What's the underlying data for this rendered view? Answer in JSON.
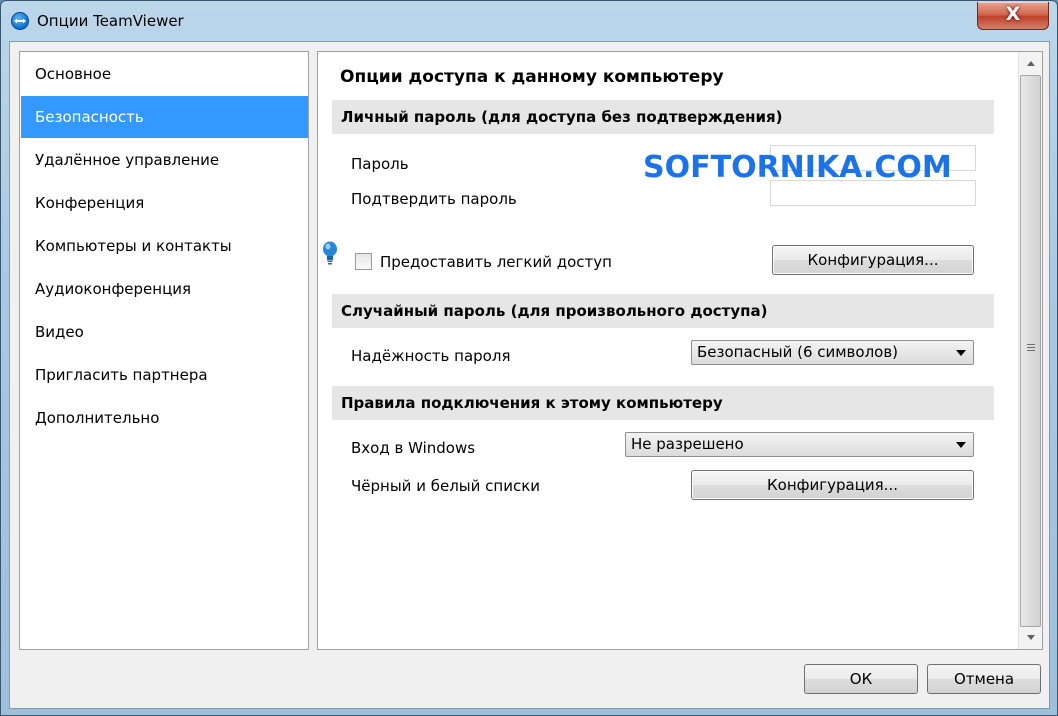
{
  "window": {
    "title": "Опции TeamViewer",
    "close_label": "X"
  },
  "sidebar": {
    "items": [
      {
        "label": "Основное",
        "active": false
      },
      {
        "label": "Безопасность",
        "active": true
      },
      {
        "label": "Удалённое управление",
        "active": false
      },
      {
        "label": "Конференция",
        "active": false
      },
      {
        "label": "Компьютеры и контакты",
        "active": false
      },
      {
        "label": "Аудиоконференция",
        "active": false
      },
      {
        "label": "Видео",
        "active": false
      },
      {
        "label": "Пригласить партнера",
        "active": false
      },
      {
        "label": "Дополнительно",
        "active": false
      }
    ]
  },
  "main": {
    "title": "Опции доступа к данному компьютеру",
    "watermark": "SOFTORNIKA.COM",
    "personal": {
      "header": "Личный пароль (для доступа без подтверждения)",
      "password_label": "Пароль",
      "password_value": "",
      "confirm_label": "Подтвердить пароль",
      "confirm_value": "",
      "easy_access_label": "Предоставить легкий доступ",
      "easy_access_checked": false,
      "config_button": "Конфигурация..."
    },
    "random": {
      "header": "Случайный пароль (для произвольного доступа)",
      "strength_label": "Надёжность пароля",
      "strength_value": "Безопасный (6 символов)"
    },
    "rules": {
      "header": "Правила подключения к этому компьютеру",
      "windows_login_label": "Вход в Windows",
      "windows_login_value": "Не разрешено",
      "lists_label": "Чёрный и белый списки",
      "lists_button": "Конфигурация..."
    }
  },
  "footer": {
    "ok_label": "ОК",
    "cancel_label": "Отмена"
  },
  "colors": {
    "selection": "#3399ff",
    "watermark": "#1a73e8",
    "section_bg": "#e6e6e6"
  }
}
